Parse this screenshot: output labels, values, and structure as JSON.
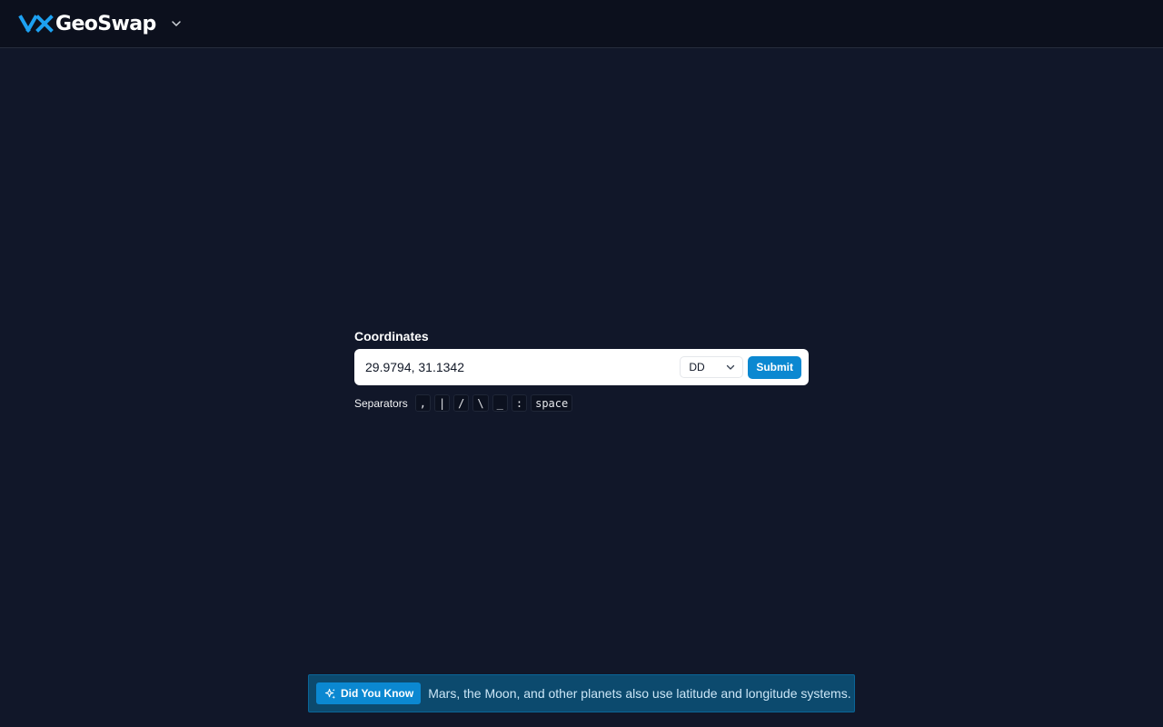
{
  "app": {
    "name": "GeoSwap",
    "logo_mark": "XX"
  },
  "header": {
    "menu_icon": "chevron-down-icon"
  },
  "form": {
    "label": "Coordinates",
    "input_value": "29.9794, 31.1342",
    "format_selected": "DD",
    "submit_label": "Submit"
  },
  "separators": {
    "label": "Separators",
    "keys": [
      ",",
      "|",
      "/",
      "\\",
      "_",
      ":",
      "space"
    ]
  },
  "tip": {
    "badge_label": "Did You Know",
    "badge_icon": "sparkles-icon",
    "text": "Mars, the Moon, and other planets also use latitude and longitude systems."
  },
  "colors": {
    "background": "#111729",
    "header": "#0c101d",
    "accent": "#0b88d1",
    "logo_mark": "#1da1f2",
    "tip_bg": "#0c4a6e"
  }
}
